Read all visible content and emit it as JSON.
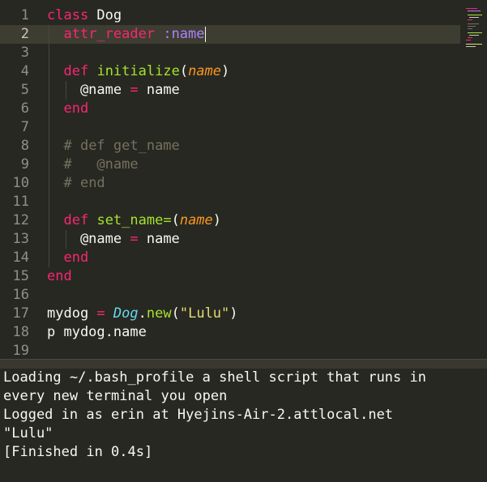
{
  "editor": {
    "language": "ruby",
    "active_line": 2,
    "line_numbers": [
      "1",
      "2",
      "3",
      "4",
      "5",
      "6",
      "7",
      "8",
      "9",
      "10",
      "11",
      "12",
      "13",
      "14",
      "15",
      "16",
      "17",
      "18",
      "19"
    ],
    "lines": [
      [
        {
          "t": "class",
          "c": "kw"
        },
        {
          "t": " Dog",
          "c": "cls"
        }
      ],
      [
        {
          "t": "  "
        },
        {
          "t": "attr_reader",
          "c": "kw"
        },
        {
          "t": " "
        },
        {
          "t": ":name",
          "c": "sym"
        },
        {
          "cursor": true
        }
      ],
      [],
      [
        {
          "t": "  "
        },
        {
          "t": "def",
          "c": "kw"
        },
        {
          "t": " "
        },
        {
          "t": "initialize",
          "c": "fn"
        },
        {
          "t": "("
        },
        {
          "t": "name",
          "c": "param"
        },
        {
          "t": ")"
        }
      ],
      [
        {
          "t": "    @name "
        },
        {
          "t": "=",
          "c": "op"
        },
        {
          "t": " name"
        }
      ],
      [
        {
          "t": "  "
        },
        {
          "t": "end",
          "c": "kw"
        }
      ],
      [],
      [
        {
          "t": "  "
        },
        {
          "t": "# def get_name",
          "c": "com"
        }
      ],
      [
        {
          "t": "  "
        },
        {
          "t": "#   @name",
          "c": "com"
        }
      ],
      [
        {
          "t": "  "
        },
        {
          "t": "# end",
          "c": "com"
        }
      ],
      [],
      [
        {
          "t": "  "
        },
        {
          "t": "def",
          "c": "kw"
        },
        {
          "t": " "
        },
        {
          "t": "set_name=",
          "c": "fn"
        },
        {
          "t": "("
        },
        {
          "t": "name",
          "c": "param"
        },
        {
          "t": ")"
        }
      ],
      [
        {
          "t": "    @name "
        },
        {
          "t": "=",
          "c": "op"
        },
        {
          "t": " name"
        }
      ],
      [
        {
          "t": "  "
        },
        {
          "t": "end",
          "c": "kw"
        }
      ],
      [
        {
          "t": "end",
          "c": "kw"
        }
      ],
      [],
      [
        {
          "t": "mydog "
        },
        {
          "t": "=",
          "c": "op"
        },
        {
          "t": " "
        },
        {
          "t": "Dog",
          "c": "type"
        },
        {
          "t": "."
        },
        {
          "t": "new",
          "c": "fn"
        },
        {
          "t": "("
        },
        {
          "t": "\"Lulu\"",
          "c": "str"
        },
        {
          "t": ")"
        }
      ],
      [
        {
          "t": "p mydog.name"
        }
      ],
      []
    ]
  },
  "output": {
    "lines": [
      "Loading ~/.bash_profile a shell script that runs in",
      "every new terminal you open",
      "Logged in as erin at Hyejins-Air-2.attlocal.net",
      "\"Lulu\"",
      "[Finished in 0.4s]"
    ]
  },
  "colors": {
    "background": "#272822",
    "keyword": "#f92672",
    "function": "#a6e22e",
    "parameter": "#fd971f",
    "symbol": "#ae81ff",
    "string": "#e6db74",
    "type": "#66d9ef",
    "comment": "#75715e"
  }
}
